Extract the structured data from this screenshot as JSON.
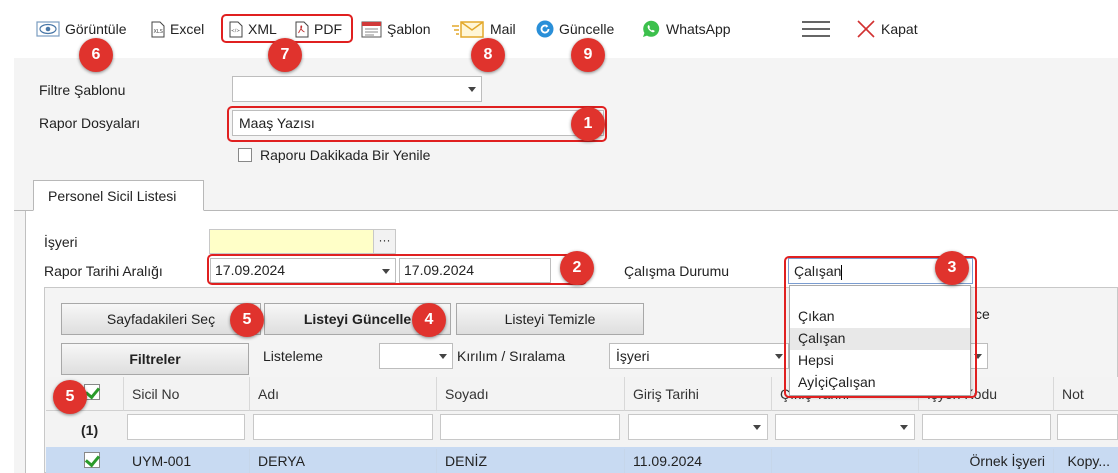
{
  "toolbar": {
    "view": "Görüntüle",
    "excel": "Excel",
    "xml": "XML",
    "pdf": "PDF",
    "template": "Şablon",
    "mail": "Mail",
    "refresh": "Güncelle",
    "whatsapp": "WhatsApp",
    "close": "Kapat"
  },
  "badges": [
    "1",
    "2",
    "3",
    "4",
    "5",
    "5",
    "6",
    "7",
    "8",
    "9"
  ],
  "form": {
    "filter_template_label": "Filtre Şablonu",
    "filter_template_value": "",
    "report_files_label": "Rapor Dosyaları",
    "report_files_value": "Maaş Yazısı",
    "auto_refresh_label": "Raporu Dakikada Bir Yenile"
  },
  "tabs": [
    "Personel Sicil Listesi"
  ],
  "panel": {
    "workplace_label": "İşyeri",
    "workplace_value": "",
    "date_range_label": "Rapor Tarihi Aralığı",
    "date_start": "17.09.2024",
    "date_end": "17.09.2024",
    "work_status_label": "Çalışma Durumu",
    "work_status_value": "Çalışan",
    "work_status_options": [
      "",
      "Çıkan",
      "Çalışan",
      "Hepsi",
      "AyİçiÇalışan"
    ],
    "hidden_partial_text": "ce"
  },
  "buttons": {
    "select_page": "Sayfadakileri Seç",
    "update_list": "Listeyi Güncelle",
    "clear_list": "Listeyi Temizle",
    "filters": "Filtreler"
  },
  "listing": {
    "listing_label": "Listeleme",
    "listing_value": "",
    "break_sort_label": "Kırılım / Sıralama",
    "break_sort_value": "İşyeri"
  },
  "grid": {
    "columns": [
      "Sicil No",
      "Adı",
      "Soyadı",
      "Giriş Tarihi",
      "Çıkış Tarihi",
      "İşyeri Kodu",
      "Not"
    ],
    "row_count_label": "(1)",
    "rows": [
      {
        "checked": true,
        "cells": [
          "UYM-001",
          "DERYA",
          "DENİZ",
          "11.09.2024",
          "",
          "Örnek İşyeri",
          "Kopy..."
        ]
      }
    ]
  },
  "colors": {
    "highlight": "#e02020",
    "badge": "#e0332d",
    "workplace_bg": "#ffffc8",
    "selected_row_bg": "#c8daf2"
  }
}
